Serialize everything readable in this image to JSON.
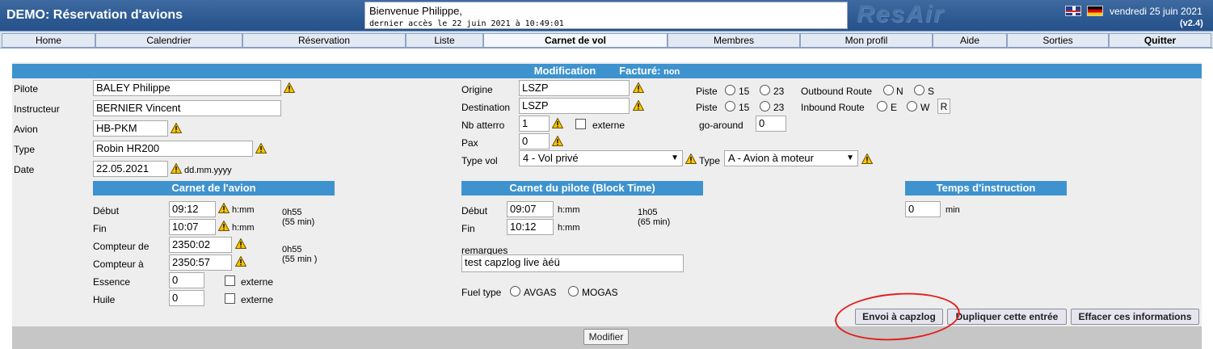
{
  "header": {
    "title": "DEMO: Réservation d'avions",
    "welcome": "Bienvenue  Philippe,",
    "last_access": "dernier accès le 22 juin 2021 à 10:49:01",
    "logo": "ResAir",
    "date": "vendredi 25 juin 2021",
    "version": "(v2.4)"
  },
  "nav": [
    "Home",
    "Calendrier",
    "Réservation",
    "Liste",
    "Carnet de vol",
    "Membres",
    "Mon profil",
    "Aide",
    "Sorties",
    "Quitter"
  ],
  "form": {
    "band_title": "Modification",
    "billed_label": "Facturé:",
    "billed_value": "non",
    "pilote_label": "Pilote",
    "pilote_value": "BALEY Philippe",
    "instructeur_label": "Instructeur",
    "instructeur_value": "BERNIER Vincent",
    "avion_label": "Avion",
    "avion_value": "HB-PKM",
    "type_label": "Type",
    "type_value": "Robin HR200",
    "date_label": "Date",
    "date_value": "22.05.2021",
    "date_format": "dd.mm.yyyy",
    "origine_label": "Origine",
    "origine_value": "LSZP",
    "destination_label": "Destination",
    "destination_value": "LSZP",
    "nb_atterro_label": "Nb atterro",
    "nb_atterro_value": "1",
    "externe_label": "externe",
    "pax_label": "Pax",
    "pax_value": "0",
    "type_vol_label": "Type vol",
    "type_vol_value": "4 - Vol privé",
    "type2_label": "Type",
    "type2_value": "A - Avion à moteur",
    "piste_label": "Piste",
    "piste_opt1": "15",
    "piste_opt2": "23",
    "outbound_label": "Outbound Route",
    "outbound_n": "N",
    "outbound_s": "S",
    "inbound_label": "Inbound Route",
    "inbound_e": "E",
    "inbound_w": "W",
    "inbound_r": "R",
    "go_around_label": "go-around",
    "go_around_value": "0"
  },
  "carnet_avion": {
    "title": "Carnet de l'avion",
    "debut_label": "Début",
    "debut_value": "09:12",
    "fin_label": "Fin",
    "fin_value": "10:07",
    "hmm": "h:mm",
    "duration1": "0h55",
    "duration1_min": "(55 min)",
    "compteur_de_label": "Compteur de",
    "compteur_de_value": "2350:02",
    "compteur_a_label": "Compteur à",
    "compteur_a_value": "2350:57",
    "duration2": "0h55",
    "duration2_min": "(55 min )",
    "essence_label": "Essence",
    "essence_value": "0",
    "huile_label": "Huile",
    "huile_value": "0",
    "externe_label": "externe"
  },
  "carnet_pilote": {
    "title": "Carnet du pilote (Block Time)",
    "debut_label": "Début",
    "debut_value": "09:07",
    "fin_label": "Fin",
    "fin_value": "10:12",
    "hmm": "h:mm",
    "duration": "1h05",
    "duration_min": "(65 min)",
    "remarques_label": "remarques",
    "remarques_value": "test capzlog live àéü",
    "fuel_type_label": "Fuel type",
    "fuel_avgas": "AVGAS",
    "fuel_mogas": "MOGAS"
  },
  "instruction": {
    "title": "Temps d'instruction",
    "value": "0",
    "unit": "min"
  },
  "buttons": {
    "capzlog": "Envoi à capzlog",
    "dupliquer": "Dupliquer cette entrée",
    "effacer": "Effacer ces informations",
    "modifier": "Modifier"
  },
  "colors": {
    "header": "#2d5a92",
    "band": "#3e93cf",
    "annotation": "#e0201e"
  }
}
